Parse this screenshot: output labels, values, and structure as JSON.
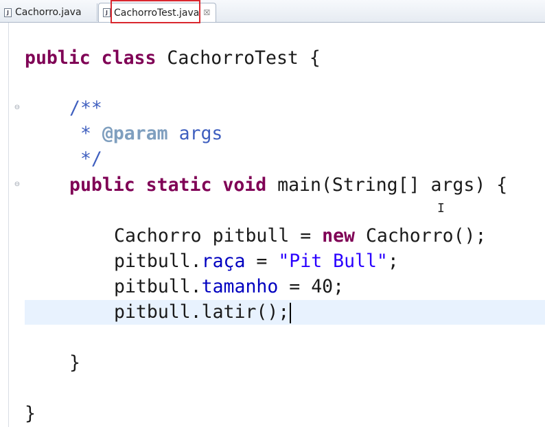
{
  "tabs": [
    {
      "label": "Cachorro.java",
      "icon": "java-file-icon",
      "active": false
    },
    {
      "label": "CachorroTest.java",
      "icon": "java-file-icon",
      "active": true,
      "close": "☒"
    }
  ],
  "code": {
    "l1": {
      "kw": "public class",
      "rest": " CachorroTest {"
    },
    "l2": {
      "text": "/**"
    },
    "l3": {
      "star": " * ",
      "tag": "@param",
      "arg": " args"
    },
    "l4": {
      "text": " */"
    },
    "l5": {
      "kw": "public static void",
      "rest": " main(String[] args) {"
    },
    "l6": {
      "a": "Cachorro pitbull = ",
      "kw": "new",
      "b": " Cachorro();"
    },
    "l7": {
      "obj": "pitbull.",
      "field": "raça",
      "eq": " = ",
      "str": "\"Pit Bull\"",
      "end": ";"
    },
    "l8": {
      "obj": "pitbull.",
      "field": "tamanho",
      "rest": " = 40;"
    },
    "l9": {
      "text": "pitbull.latir();"
    },
    "l10": {
      "text": "}"
    },
    "l11": {
      "text": "}"
    }
  },
  "colors": {
    "keyword": "#7f0055",
    "javadoc": "#3f5fbf",
    "string": "#2a00ff",
    "field": "#0000c0",
    "current_line": "#e8f2fe",
    "highlight_box": "#d9272e"
  }
}
